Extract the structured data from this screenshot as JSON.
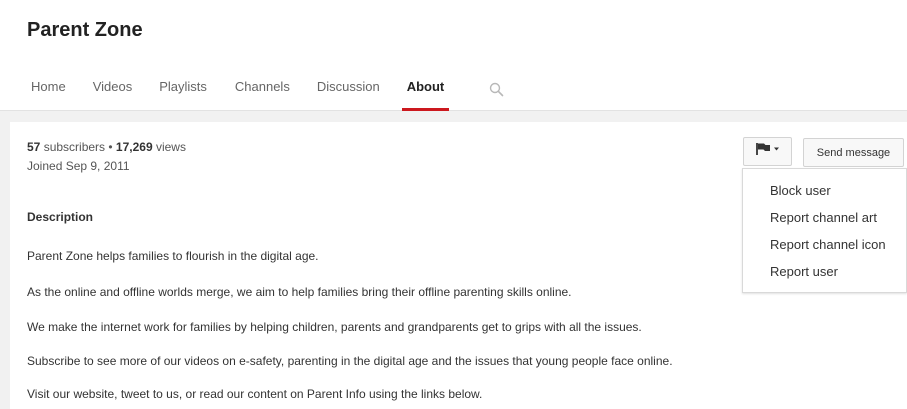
{
  "channel": {
    "name": "Parent Zone"
  },
  "tabs": [
    {
      "label": "Home"
    },
    {
      "label": "Videos"
    },
    {
      "label": "Playlists"
    },
    {
      "label": "Channels"
    },
    {
      "label": "Discussion"
    },
    {
      "label": "About",
      "active": true
    }
  ],
  "stats": {
    "subscribers_count": "57",
    "subscribers_label": " subscribers • ",
    "views_count": "17,269",
    "views_label": " views",
    "joined": "Joined Sep 9, 2011"
  },
  "description": {
    "title": "Description",
    "lines": [
      "Parent Zone helps families to flourish in the digital age.",
      "As the online and offline worlds merge, we aim to help families bring their offline parenting skills online.",
      "We  make the internet work for families by helping children, parents and grandparents get to grips with all the issues.",
      "Subscribe to see more of our videos on e-safety, parenting in the digital age and the issues that young people face online.",
      "Visit our website, tweet to us, or read our content on Parent Info using the links below."
    ]
  },
  "actions": {
    "flag_icon": "flag-icon",
    "send_message": "Send message"
  },
  "menu": {
    "items": [
      "Block user",
      "Report channel art",
      "Report channel icon",
      "Report user"
    ]
  },
  "colors": {
    "accent": "#cc181e",
    "background": "#f1f1f1",
    "card": "#ffffff"
  }
}
